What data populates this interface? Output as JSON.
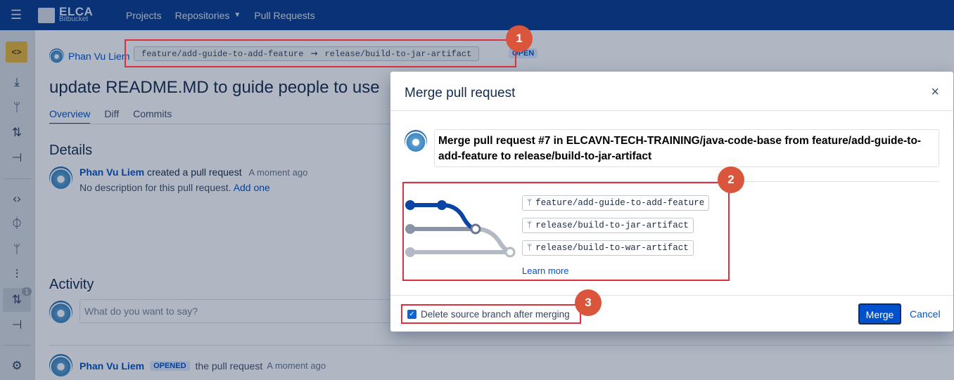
{
  "topbar": {
    "logo_title": "ELCA",
    "logo_subtitle": "Bitbucket",
    "nav": [
      "Projects",
      "Repositories",
      "Pull Requests"
    ]
  },
  "sidebar": {
    "badge": "1",
    "icons": [
      "repository-icon",
      "clone-icon",
      "create-branch-icon",
      "create-pull-request-icon",
      "fork-icon",
      "source-icon",
      "commits-icon",
      "branches-icon",
      "tags-icon",
      "pull-requests-icon",
      "forks-icon",
      "settings-icon"
    ]
  },
  "pr": {
    "author": "Phan Vu Liem",
    "source_branch": "feature/add-guide-to-add-feature",
    "arrow": "→",
    "target_branch": "release/build-to-jar-artifact",
    "status": "OPEN",
    "title": "update README.MD to guide people to use",
    "tabs": [
      "Overview",
      "Diff",
      "Commits"
    ]
  },
  "details": {
    "heading": "Details",
    "author": "Phan Vu Liem",
    "action": "created a pull request",
    "time": "A moment ago",
    "desc": "No description for this pull request.",
    "add_link": "Add one"
  },
  "activity": {
    "heading": "Activity",
    "placeholder": "What do you want to say?",
    "author": "Phan Vu Liem",
    "lozenge": "OPENED",
    "action": "the pull request",
    "time": "A moment ago"
  },
  "modal": {
    "title": "Merge pull request",
    "close": "×",
    "message": "Merge pull request #7 in ELCAVN-TECH-TRAINING/java-code-base from feature/add-guide-to-add-feature to release/build-to-jar-artifact",
    "branches": [
      "feature/add-guide-to-add-feature",
      "release/build-to-jar-artifact",
      "release/build-to-war-artifact"
    ],
    "learn_more": "Learn more",
    "delete_branch_label": "Delete source branch after merging",
    "delete_branch_checked": true,
    "merge_label": "Merge",
    "cancel_label": "Cancel"
  },
  "annotations": [
    "1",
    "2",
    "3"
  ],
  "colors": {
    "topbar": "#0a3d8f",
    "accent": "#0052cc",
    "annotation": "#d9553b",
    "annotation_box": "#e02f3a",
    "graph_feature": "#0b44a4",
    "graph_release_jar": "#6b778c",
    "graph_release_war": "#b3bac5"
  }
}
